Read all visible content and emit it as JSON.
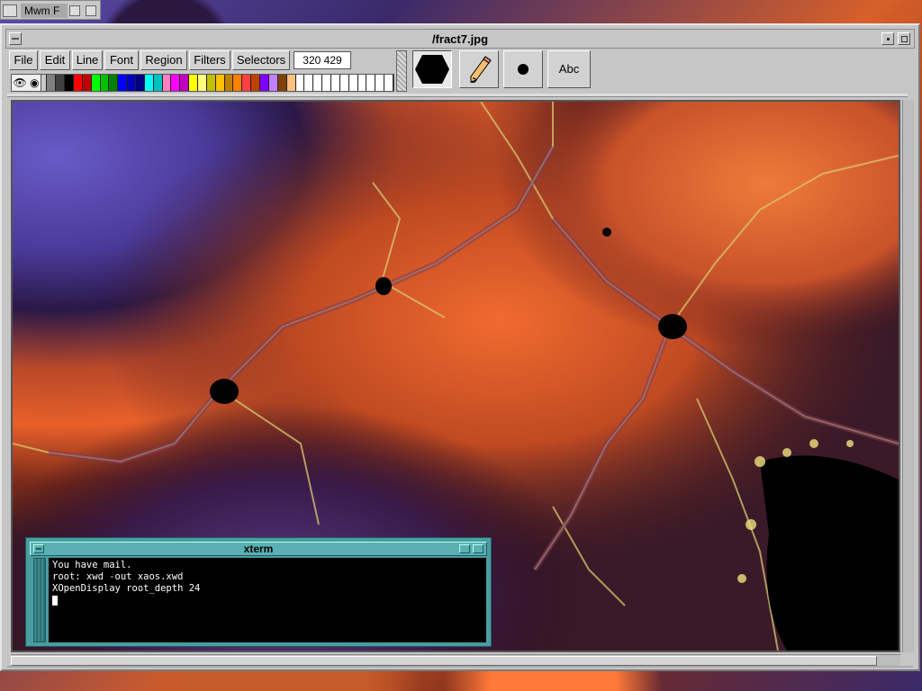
{
  "background_window": {
    "title": "Mwm F"
  },
  "paint": {
    "title": "/fract7.jpg",
    "menu": [
      "File",
      "Edit",
      "Line",
      "Font",
      "Region",
      "Filters",
      "Selectors"
    ],
    "coords": "320 429",
    "tools": {
      "hex": "polygon-tool",
      "pencil": "pencil-tool",
      "dot": "brush-tool",
      "text_label": "Abc"
    },
    "palette": [
      "#ffffff",
      "#000000",
      "#ffffff",
      "#c8c8c8",
      "#808080",
      "#404040",
      "#000000",
      "#ff0000",
      "#c00000",
      "#00ff00",
      "#00c000",
      "#008000",
      "#0000ff",
      "#0000c0",
      "#000080",
      "#00ffff",
      "#00c0c0",
      "#ff80c0",
      "#ff00ff",
      "#c000c0",
      "#ffff00",
      "#ffff80",
      "#c0c000",
      "#ffc000",
      "#c08000",
      "#ff8000",
      "#ff4040",
      "#c04000",
      "#8000ff",
      "#c080ff",
      "#804000",
      "#ffc080",
      "#ffffff",
      "#ffffff",
      "#ffffff",
      "#ffffff",
      "#ffffff",
      "#ffffff",
      "#ffffff",
      "#ffffff",
      "#ffffff",
      "#ffffff",
      "#ffffff"
    ]
  },
  "xterm": {
    "title": "xterm",
    "lines": [
      "You have mail.",
      "root: xwd -out xaos.xwd",
      "XOpenDisplay root_depth 24"
    ]
  },
  "colors": {
    "xterm_frame": "#4a9da0",
    "fractal_orange": "#d8602a",
    "fractal_purple": "#4a3a8a"
  }
}
